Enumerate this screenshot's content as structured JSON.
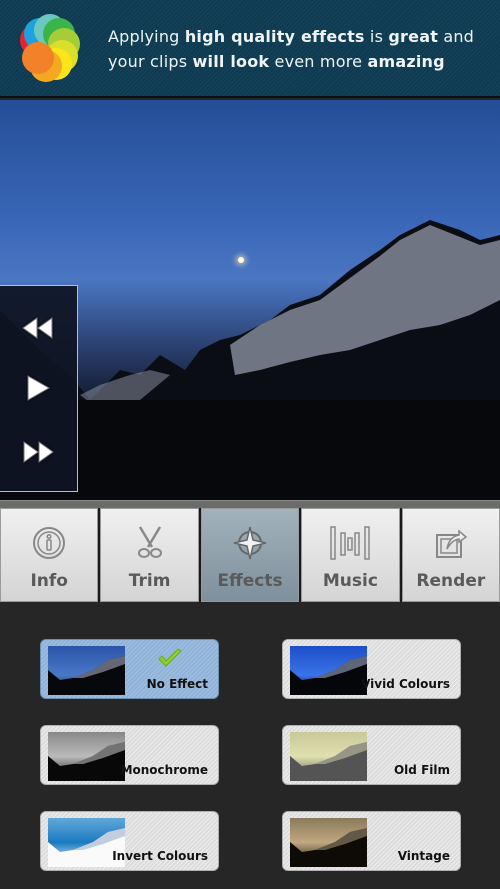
{
  "banner": {
    "logo": "colorful-flower-logo",
    "line1": [
      {
        "text": "Applying ",
        "bold": false
      },
      {
        "text": "high quality effects",
        "bold": true
      },
      {
        "text": " is ",
        "bold": false
      },
      {
        "text": "great",
        "bold": true
      },
      {
        "text": " and",
        "bold": false
      }
    ],
    "line2": [
      {
        "text": "your clips ",
        "bold": false
      },
      {
        "text": "will look",
        "bold": true
      },
      {
        "text": " even more ",
        "bold": false
      },
      {
        "text": "amazing",
        "bold": true
      }
    ]
  },
  "player": {
    "controls": [
      {
        "name": "rewind",
        "icon": "rewind-icon"
      },
      {
        "name": "play",
        "icon": "play-icon"
      },
      {
        "name": "fast-forward",
        "icon": "fast-forward-icon"
      }
    ]
  },
  "tabs": [
    {
      "label": "Info",
      "icon": "info-icon",
      "active": false
    },
    {
      "label": "Trim",
      "icon": "scissors-icon",
      "active": false
    },
    {
      "label": "Effects",
      "icon": "compass-star-icon",
      "active": true
    },
    {
      "label": "Music",
      "icon": "equalizer-bars-icon",
      "active": false
    },
    {
      "label": "Render",
      "icon": "share-export-icon",
      "active": false
    }
  ],
  "effects": [
    {
      "label": "No Effect",
      "selected": true,
      "filter": "none"
    },
    {
      "label": "Vivid Colours",
      "selected": false,
      "filter": "vivid"
    },
    {
      "label": "Monochrome",
      "selected": false,
      "filter": "mono"
    },
    {
      "label": "Old Film",
      "selected": false,
      "filter": "oldfilm"
    },
    {
      "label": "Invert Colours",
      "selected": false,
      "filter": "invert"
    },
    {
      "label": "Vintage",
      "selected": false,
      "filter": "vintage"
    }
  ],
  "colors": {
    "banner_bg": "#0e3b52",
    "selected_effect": "#8fb2d8",
    "active_tab": "#8a9ca8",
    "check_green": "#8cd22a"
  }
}
